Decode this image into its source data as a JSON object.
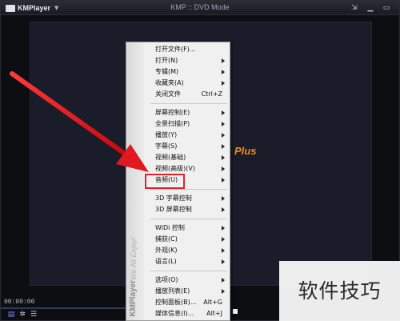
{
  "window": {
    "app_name": "KMPlayer",
    "title": "KMP :: DVD Mode",
    "plus_badge": "Plus",
    "time": "00:00:00"
  },
  "menu": {
    "brand": "KMPlayer",
    "tagline": "We All Enjoy!",
    "groups": [
      [
        {
          "label": "打开文件(F)...",
          "shortcut": "",
          "submenu": false
        },
        {
          "label": "打开(N)",
          "shortcut": "",
          "submenu": true
        },
        {
          "label": "专辑(M)",
          "shortcut": "",
          "submenu": true
        },
        {
          "label": "收藏夹(A)",
          "shortcut": "",
          "submenu": true
        },
        {
          "label": "关闭文件",
          "shortcut": "Ctrl+Z",
          "submenu": false
        }
      ],
      [
        {
          "label": "屏幕控制(E)",
          "shortcut": "",
          "submenu": true
        },
        {
          "label": "全景扫描(P)",
          "shortcut": "",
          "submenu": true
        },
        {
          "label": "播放(Y)",
          "shortcut": "",
          "submenu": true
        },
        {
          "label": "字幕(S)",
          "shortcut": "",
          "submenu": true
        },
        {
          "label": "视频(基础)",
          "shortcut": "",
          "submenu": true
        },
        {
          "label": "视频(高级)(V)",
          "shortcut": "",
          "submenu": true
        },
        {
          "label": "音频(U)",
          "shortcut": "",
          "submenu": true
        }
      ],
      [
        {
          "label": "3D 字幕控制",
          "shortcut": "",
          "submenu": true
        },
        {
          "label": "3D 屏幕控制",
          "shortcut": "",
          "submenu": true
        }
      ],
      [
        {
          "label": "WiDi 控制",
          "shortcut": "",
          "submenu": true
        },
        {
          "label": "捕获(C)",
          "shortcut": "",
          "submenu": true
        },
        {
          "label": "外观(K)",
          "shortcut": "",
          "submenu": true
        },
        {
          "label": "语言(L)",
          "shortcut": "",
          "submenu": true
        }
      ],
      [
        {
          "label": "选项(O)",
          "shortcut": "",
          "submenu": true
        },
        {
          "label": "播放列表(E)",
          "shortcut": "",
          "submenu": true
        },
        {
          "label": "控制面板(B)...",
          "shortcut": "Alt+G",
          "submenu": false
        },
        {
          "label": "媒体信息(I)...",
          "shortcut": "Alt+J",
          "submenu": false
        }
      ]
    ]
  },
  "annotation": {
    "highlight_item": "音频(U)",
    "arrow_color": "#e0191f"
  },
  "watermark": "软件技巧"
}
